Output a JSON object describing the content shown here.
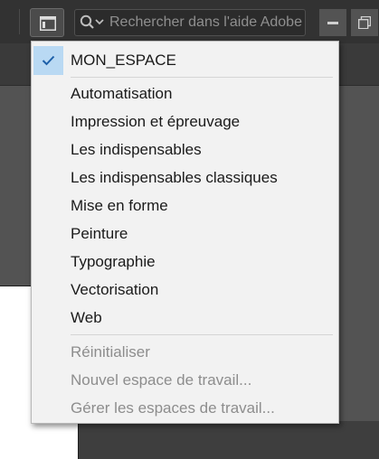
{
  "toolbar": {
    "workspace_button_icon": "workspace-layout-icon",
    "help_search": {
      "icon": "search-dropdown-icon",
      "placeholder": "Rechercher dans l'aide Adobe",
      "value": ""
    },
    "window_controls": {
      "minimize_icon": "minimize-icon",
      "restore_icon": "restore-icon"
    }
  },
  "workspace_menu": {
    "selected": {
      "label": "MON_ESPACE",
      "check_icon": "checkmark-icon"
    },
    "presets": [
      {
        "label": "Automatisation"
      },
      {
        "label": "Impression et épreuvage"
      },
      {
        "label": "Les indispensables"
      },
      {
        "label": "Les indispensables classiques"
      },
      {
        "label": "Mise en forme"
      },
      {
        "label": "Peinture"
      },
      {
        "label": "Typographie"
      },
      {
        "label": "Vectorisation"
      },
      {
        "label": "Web"
      }
    ],
    "actions": [
      {
        "label": "Réinitialiser",
        "enabled": false
      },
      {
        "label": "Nouvel espace de travail...",
        "enabled": false
      },
      {
        "label": "Gérer les espaces de travail...",
        "enabled": false
      }
    ]
  },
  "colors": {
    "menu_bg": "#f2f2f2",
    "selection_highlight": "#b9d9f3",
    "check_color": "#1c5fa8",
    "disabled_text": "#8d8d8d",
    "app_bg": "#535353",
    "topbar_bg": "#323232"
  }
}
